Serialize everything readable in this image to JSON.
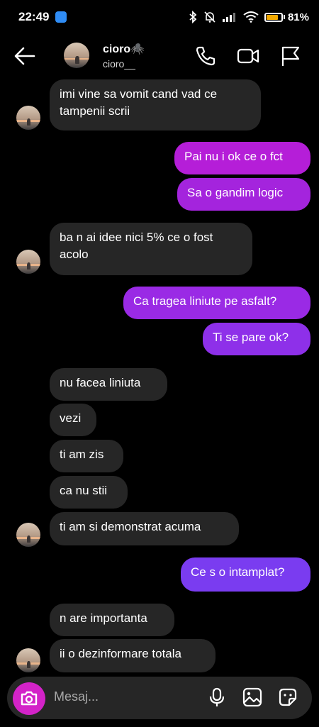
{
  "status_bar": {
    "time": "22:49",
    "battery_percent": "81%",
    "battery_level": 0.81,
    "accent": "#f2a900"
  },
  "header": {
    "name": "cioro🕷️",
    "username": "cioro__"
  },
  "messages": [
    {
      "side": "in",
      "text_lines": [
        "imi vine sa vomit cand vad ce",
        "tampenii scrii"
      ]
    },
    {
      "side": "out",
      "text": "Pai nu i ok ce o fct"
    },
    {
      "side": "out",
      "text": "Sa o gandim logic"
    },
    {
      "side": "in",
      "text_lines": [
        "ba n ai idee nici 5% ce o fost",
        "acolo"
      ]
    },
    {
      "side": "out",
      "text": "Ca tragea liniute pe asfalt?"
    },
    {
      "side": "out",
      "text": "Ti se pare ok?"
    },
    {
      "side": "in",
      "text": "nu facea liniuta"
    },
    {
      "side": "in",
      "text": "vezi"
    },
    {
      "side": "in",
      "text": "ti am zis"
    },
    {
      "side": "in",
      "text": "ca nu stii"
    },
    {
      "side": "in",
      "text": "ti am si demonstrat acuma"
    },
    {
      "side": "out",
      "text": "Ce s o intamplat?"
    },
    {
      "side": "in",
      "text": "n are importanta"
    },
    {
      "side": "in",
      "text": "ii o dezinformare totala"
    }
  ],
  "composer": {
    "placeholder": "Mesaj..."
  },
  "colors": {
    "incoming_bubble": "#262626",
    "outgoing_magenta": "#b51ed8",
    "outgoing_violet": "#7a3cf0",
    "camera_button": "#d323c8"
  },
  "icons": {
    "back": "arrow-left-icon",
    "call": "phone-icon",
    "video": "video-camera-icon",
    "report": "flag-icon",
    "camera": "camera-icon",
    "mic": "microphone-icon",
    "gallery": "image-icon",
    "sticker": "sticker-icon"
  }
}
